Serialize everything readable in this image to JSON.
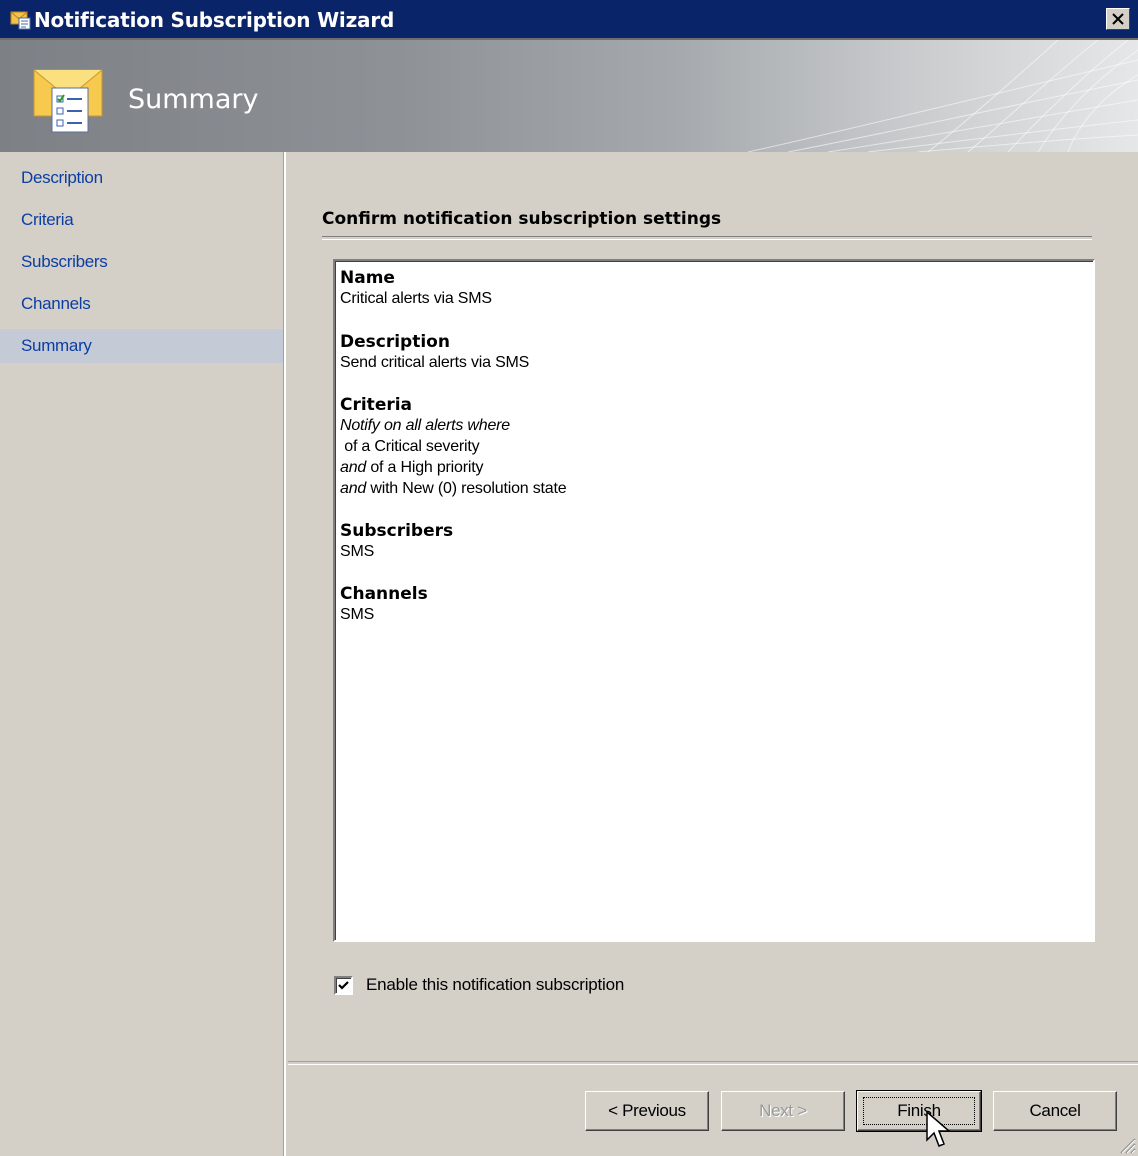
{
  "window": {
    "title": "Notification Subscription Wizard",
    "close_glyph": "✕"
  },
  "banner": {
    "title": "Summary",
    "icon": "envelope-checklist-icon"
  },
  "nav": {
    "items": [
      {
        "label": "Description"
      },
      {
        "label": "Criteria"
      },
      {
        "label": "Subscribers"
      },
      {
        "label": "Channels"
      },
      {
        "label": "Summary",
        "active": true
      }
    ]
  },
  "main": {
    "section_title": "Confirm notification subscription settings",
    "summary": {
      "name_heading": "Name",
      "name_value": "Critical alerts via SMS",
      "description_heading": "Description",
      "description_value": "Send critical alerts via SMS",
      "criteria_heading": "Criteria",
      "criteria_intro": "Notify on all alerts where",
      "criteria_line1": " of a Critical severity",
      "criteria_and": "and",
      "criteria_line2": " of a High priority",
      "criteria_line3": " with New (0) resolution state",
      "subscribers_heading": "Subscribers",
      "subscribers_value": "SMS",
      "channels_heading": "Channels",
      "channels_value": "SMS"
    },
    "enable_checkbox": {
      "label": "Enable this notification subscription",
      "checked": true
    }
  },
  "buttons": {
    "previous": "< Previous",
    "next": "Next >",
    "finish": "Finish",
    "cancel": "Cancel"
  }
}
